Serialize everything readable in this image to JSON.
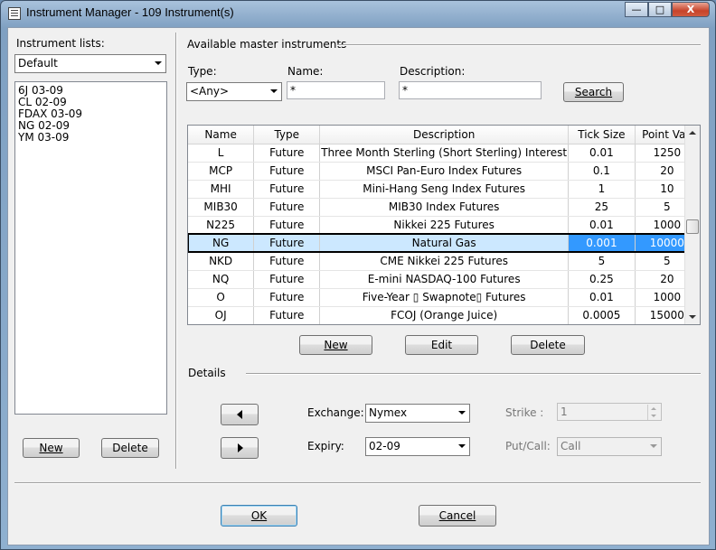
{
  "window": {
    "title": "Instrument Manager - 109 Instrument(s)",
    "min_glyph": "—",
    "max_glyph": "□",
    "close_glyph": "X"
  },
  "left": {
    "lists_label": "Instrument lists:",
    "list_selected": "Default",
    "items": [
      "6J 03-09",
      "CL 02-09",
      "FDAX 03-09",
      "NG 02-09",
      "YM 03-09"
    ],
    "new_label": "New",
    "delete_label": "Delete"
  },
  "master": {
    "group_label": "Available master instruments",
    "type_label": "Type:",
    "type_value": "<Any>",
    "name_label": "Name:",
    "name_value": "*",
    "desc_label": "Description:",
    "desc_value": "*",
    "search_label": "Search",
    "columns": [
      "Name",
      "Type",
      "Description",
      "Tick Size",
      "Point Val."
    ],
    "rows": [
      [
        "L",
        "Future",
        "Three Month Sterling (Short Sterling) Interest",
        "0.01",
        "1250"
      ],
      [
        "MCP",
        "Future",
        "MSCI Pan-Euro Index Futures",
        "0.1",
        "20"
      ],
      [
        "MHI",
        "Future",
        "Mini-Hang Seng Index Futures",
        "1",
        "10"
      ],
      [
        "MIB30",
        "Future",
        "MIB30 Index Futures",
        "25",
        "5"
      ],
      [
        "N225",
        "Future",
        "Nikkei 225 Futures",
        "0.01",
        "1000"
      ],
      [
        "NG",
        "Future",
        "Natural Gas",
        "0.001",
        "10000"
      ],
      [
        "NKD",
        "Future",
        "CME Nikkei 225 Futures",
        "5",
        "5"
      ],
      [
        "NQ",
        "Future",
        "E-mini NASDAQ-100 Futures",
        "0.25",
        "20"
      ],
      [
        "O",
        "Future",
        "Five-Year ▯ Swapnote▯ Futures",
        "0.01",
        "1000"
      ],
      [
        "OJ",
        "Future",
        "FCOJ (Orange Juice)",
        "0.0005",
        "15000"
      ]
    ],
    "selected_row": 5,
    "new_label": "New",
    "edit_label": "Edit",
    "delete_label": "Delete"
  },
  "details": {
    "group_label": "Details",
    "exchange_label": "Exchange:",
    "exchange_value": "Nymex",
    "expiry_label": "Expiry:",
    "expiry_value": "02-09",
    "strike_label": "Strike :",
    "strike_value": "1",
    "putcall_label": "Put/Call:",
    "putcall_value": "Call"
  },
  "footer": {
    "ok_label": "OK",
    "cancel_label": "Cancel"
  }
}
